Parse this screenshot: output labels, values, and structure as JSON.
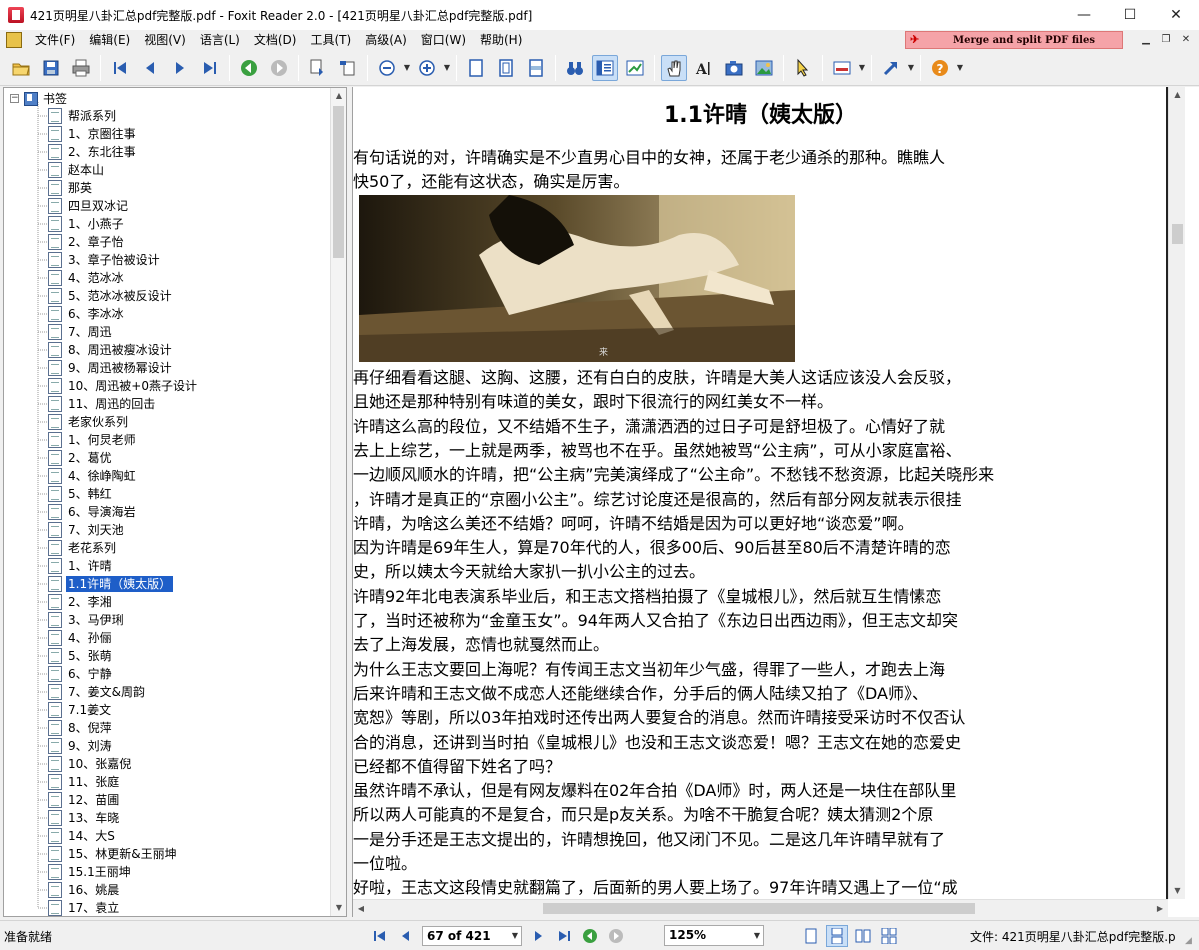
{
  "window": {
    "title": "421页明星八卦汇总pdf完整版.pdf - Foxit Reader 2.0 - [421页明星八卦汇总pdf完整版.pdf]",
    "minimize": "—",
    "maximize": "☐",
    "close": "✕"
  },
  "menu": {
    "items": [
      "文件(F)",
      "编辑(E)",
      "视图(V)",
      "语言(L)",
      "文档(D)",
      "工具(T)",
      "高级(A)",
      "窗口(W)",
      "帮助(H)"
    ],
    "ad_banner": "Merge and split PDF files"
  },
  "bookmarks": {
    "root": "书签",
    "items": [
      "帮派系列",
      "1、京圈往事",
      "2、东北往事",
      "赵本山",
      "那英",
      "四旦双冰记",
      "1、小燕子",
      "2、章子怡",
      "3、章子怡被设计",
      "4、范冰冰",
      "5、范冰冰被反设计",
      "6、李冰冰",
      "7、周迅",
      "8、周迅被瘦冰设计",
      "9、周迅被杨幂设计",
      "10、周迅被+0燕子设计",
      "11、周迅的回击",
      "老家伙系列",
      "1、何炅老师",
      "2、葛优",
      "4、徐峥陶虹",
      "5、韩红",
      "6、导演海岩",
      "7、刘天池",
      "老花系列",
      "1、许晴",
      "1.1许晴（姨太版）",
      "2、李湘",
      "3、马伊琍",
      "4、孙俪",
      "5、张萌",
      "6、宁静",
      "7、姜文&周韵",
      "7.1姜文",
      "8、倪萍",
      "9、刘涛",
      "10、张嘉倪",
      "11、张庭",
      "12、苗圃",
      "13、车晓",
      "14、大S",
      "15、林更新&王丽坤",
      "15.1王丽坤",
      "16、姚晨",
      "17、袁立"
    ],
    "selected_index": 26
  },
  "document": {
    "title": "1.1许晴（姨太版）",
    "photo_caption": "来",
    "paragraphs_before_photo": [
      "有句话说的对，许晴确实是不少直男心目中的女神，还属于老少通杀的那种。瞧瞧人",
      "快50了，还能有这状态，确实是厉害。"
    ],
    "paragraphs_after_photo": [
      "再仔细看看这腿、这胸、这腰，还有白白的皮肤，许晴是大美人这话应该没人会反驳，",
      "且她还是那种特别有味道的美女，跟时下很流行的网红美女不一样。",
      "许晴这么高的段位，又不结婚不生子，潇潇洒洒的过日子可是舒坦极了。心情好了就",
      "去上上综艺，一上就是两季，被骂也不在乎。虽然她被骂“公主病”，可从小家庭富裕、",
      "一边顺风顺水的许晴，把“公主病”完美演绎成了“公主命”。不愁钱不愁资源，比起关晓彤来",
      "，许晴才是真正的“京圈小公主”。综艺讨论度还是很高的，然后有部分网友就表示很挂",
      "许晴，为啥这么美还不结婚？呵呵，许晴不结婚是因为可以更好地“谈恋爱”啊。",
      "因为许晴是69年生人，算是70年代的人，很多00后、90后甚至80后不清楚许晴的恋",
      "史，所以姨太今天就给大家扒一扒小公主的过去。",
      "许晴92年北电表演系毕业后，和王志文搭档拍摄了《皇城根儿》，然后就互生情愫恋",
      "了，当时还被称为“金童玉女”。94年两人又合拍了《东边日出西边雨》，但王志文却突",
      "去了上海发展，恋情也就戛然而止。",
      "为什么王志文要回上海呢？有传闻王志文当初年少气盛，得罪了一些人，才跑去上海",
      "后来许晴和王志文做不成恋人还能继续合作，分手后的俩人陆续又拍了《DA师》、",
      "宽恕》等剧，所以03年拍戏时还传出两人要复合的消息。然而许晴接受采访时不仅否认",
      "合的消息，还讲到当时拍《皇城根儿》也没和王志文谈恋爱！嗯？王志文在她的恋爱史",
      "已经都不值得留下姓名了吗？",
      "虽然许晴不承认，但是有网友爆料在02年合拍《DA师》时，两人还是一块住在部队里",
      "所以两人可能真的不是复合，而只是p友关系。为啥不干脆复合呢？姨太猜测2个原",
      "一是分手还是王志文提出的，许晴想挽回，他又闭门不见。二是这几年许晴早就有了",
      "一位啦。",
      "好啦，王志文这段情史就翻篇了，后面新的男人要上场了。97年许晴又遇上了一位“成"
    ]
  },
  "status": {
    "ready": "准备就绪",
    "page_field": "67 of 421",
    "zoom": "125%",
    "file": "文件: 421页明星八卦汇总pdf完整版.p"
  },
  "colors": {
    "selection": "#1e5ec8",
    "ad_banner_bg": "#f5a3a8",
    "toolbar_active": "#c9dff7"
  }
}
